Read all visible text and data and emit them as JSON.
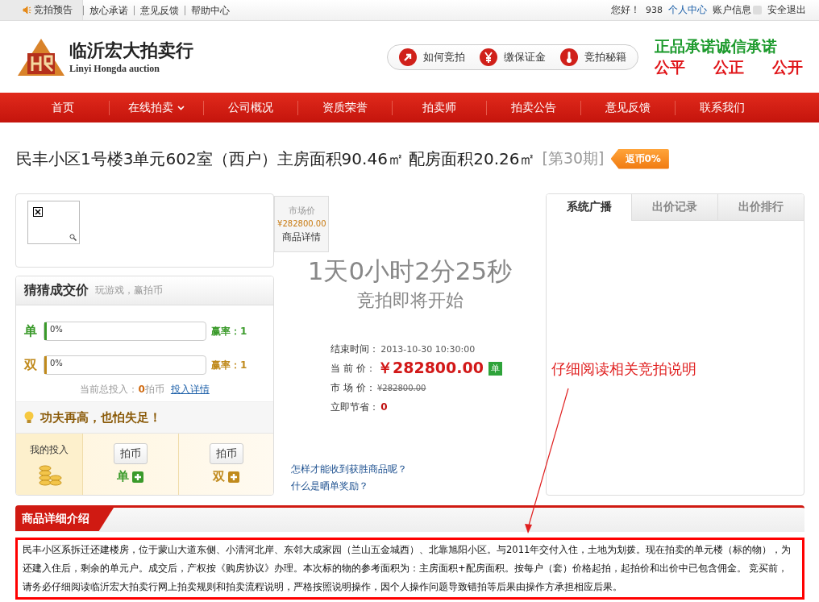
{
  "top_bar": {
    "announcement": "竞拍预告",
    "links": [
      "放心承诺",
      "意见反馈",
      "帮助中心"
    ],
    "greeting": "您好！",
    "user_id": "938",
    "user_center": "个人中心",
    "account": "账户信息",
    "logout": "安全退出"
  },
  "header": {
    "logo_cn": "临沂宏大拍卖行",
    "logo_en": "Linyi Hongda auction",
    "guide_buttons": [
      {
        "label": "如何竞拍",
        "kind": "play"
      },
      {
        "label": "缴保证金",
        "kind": "yen"
      },
      {
        "label": "竞拍秘籍",
        "kind": "thermo"
      }
    ],
    "slogan_top": "正品承诺诚信承诺",
    "slogan_bottom": [
      "公平",
      "公正",
      "公开"
    ]
  },
  "nav": [
    {
      "label": "首页",
      "dropdown": false
    },
    {
      "label": "在线拍卖",
      "dropdown": true
    },
    {
      "label": "公司概况",
      "dropdown": false
    },
    {
      "label": "资质荣誉",
      "dropdown": false
    },
    {
      "label": "拍卖师",
      "dropdown": false
    },
    {
      "label": "拍卖公告",
      "dropdown": false
    },
    {
      "label": "意见反馈",
      "dropdown": false
    },
    {
      "label": "联系我们",
      "dropdown": false
    }
  ],
  "product": {
    "title": "民丰小区1号楼3单元602室（西户）主房面积90.46㎡ 配房面积20.26㎡",
    "period": "[第30期]",
    "rebate_badge": "返币0%"
  },
  "side_tab": {
    "label": "市场价",
    "price": "¥282800.00",
    "details": "商品详情"
  },
  "guess": {
    "title": "猜猜成交价",
    "subtitle": "玩游戏，赢拍币",
    "options": [
      {
        "label": "单",
        "kind": "odd",
        "level": 0,
        "percent": "0%",
        "odds": "赢率：1"
      },
      {
        "label": "双",
        "kind": "even",
        "level": 0,
        "percent": "0%",
        "odds": "赢率：1"
      }
    ],
    "total_label": "当前总投入：",
    "total_value": "0",
    "total_unit": "拍币",
    "details_link": "投入详情",
    "tip": "功夫再高，也怕失足！",
    "my_bet": "我的投入",
    "bet_buttons": [
      {
        "coin": "拍币",
        "label": "单",
        "kind": "odd"
      },
      {
        "coin": "拍币",
        "label": "双",
        "kind": "even"
      }
    ]
  },
  "countdown": {
    "time": "1天0小时2分25秒",
    "status": "竞拍即将开始"
  },
  "info": [
    {
      "label": "结束时间：",
      "value": "2013-10-30 10:30:00",
      "kind": "time"
    },
    {
      "label": "当 前 价：",
      "value": "￥282800.00",
      "kind": "current",
      "badge": "单"
    },
    {
      "label": "市 场 价：",
      "value": "¥282800.00",
      "kind": "strike"
    },
    {
      "label": "立即节省：",
      "value": "0",
      "kind": "saving"
    }
  ],
  "help_links": [
    "怎样才能收到获胜商品呢？",
    "什么是晒单奖励？"
  ],
  "tabs": [
    {
      "label": "系统广播",
      "selected": true
    },
    {
      "label": "出价记录",
      "selected": false
    },
    {
      "label": "出价排行",
      "selected": false
    }
  ],
  "annotation": "仔细阅读相关竞拍说明",
  "details": {
    "heading": "商品详细介绍",
    "text": "民丰小区系拆迁还建楼房，位于蒙山大道东侧、小清河北岸、东邻大成家园（兰山五金城西）、北靠旭阳小区。与2011年交付入住，土地为划拨。现在拍卖的单元楼（标的物），为还建入住后，剩余的单元户。成交后，产权按《购房协议》办理。本次标的物的参考面积为：主房面积+配房面积。按每户（套）价格起拍，起拍价和出价中已包含佣金。 竞买前，请务必仔细阅读临沂宏大拍卖行网上拍卖规则和拍卖流程说明，严格按照说明操作，因个人操作问题导致错拍等后果由操作方承担相应后果。"
  }
}
